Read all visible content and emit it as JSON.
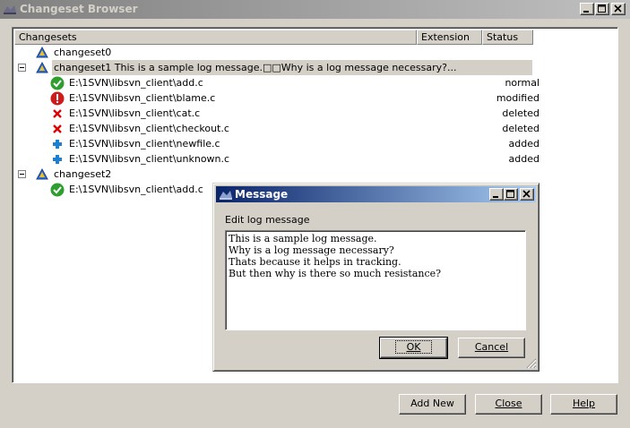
{
  "window": {
    "title": "Changeset Browser",
    "controls": [
      "minimize",
      "maximize",
      "close"
    ]
  },
  "list": {
    "columns": [
      "Changesets",
      "Extension",
      "Status"
    ],
    "rows": [
      {
        "label": "changeset0",
        "status": "",
        "icon": "changeset-icon"
      },
      {
        "label": "changeset1 This is a sample log message.□□Why is a log message necessary?...",
        "status": "",
        "icon": "changeset-icon"
      },
      {
        "label": "E:\\1SVN\\libsvn_client\\add.c",
        "status": "normal",
        "icon": "check-icon"
      },
      {
        "label": "E:\\1SVN\\libsvn_client\\blame.c",
        "status": "modified",
        "icon": "warning-icon"
      },
      {
        "label": "E:\\1SVN\\libsvn_client\\cat.c",
        "status": "deleted",
        "icon": "delete-icon"
      },
      {
        "label": "E:\\1SVN\\libsvn_client\\checkout.c",
        "status": "deleted",
        "icon": "delete-icon"
      },
      {
        "label": "E:\\1SVN\\libsvn_client\\newfile.c",
        "status": "added",
        "icon": "add-icon"
      },
      {
        "label": "E:\\1SVN\\libsvn_client\\unknown.c",
        "status": "added",
        "icon": "add-icon"
      },
      {
        "label": "changeset2",
        "status": "",
        "icon": "changeset-icon"
      },
      {
        "label": "E:\\1SVN\\libsvn_client\\add.c",
        "status": "",
        "icon": "check-icon"
      }
    ]
  },
  "buttons": {
    "add_new": "Add New",
    "close": "Close",
    "help": "Help"
  },
  "dialog": {
    "title": "Message",
    "prompt": "Edit log message",
    "text_lines": [
      "This is a sample log message.",
      "Why is a log message necessary?",
      "Thats because it helps in tracking.",
      "But then why is there so much resistance?"
    ],
    "ok": "OK",
    "cancel": "Cancel"
  },
  "colors": {
    "face": "#d4d0c8",
    "active_title": "#0a246a",
    "inactive_title": "#808080",
    "check_green": "#2e9e2e",
    "warning_red": "#d11a1a",
    "delete_red": "#e00000",
    "add_blue": "#1e7fd0"
  }
}
